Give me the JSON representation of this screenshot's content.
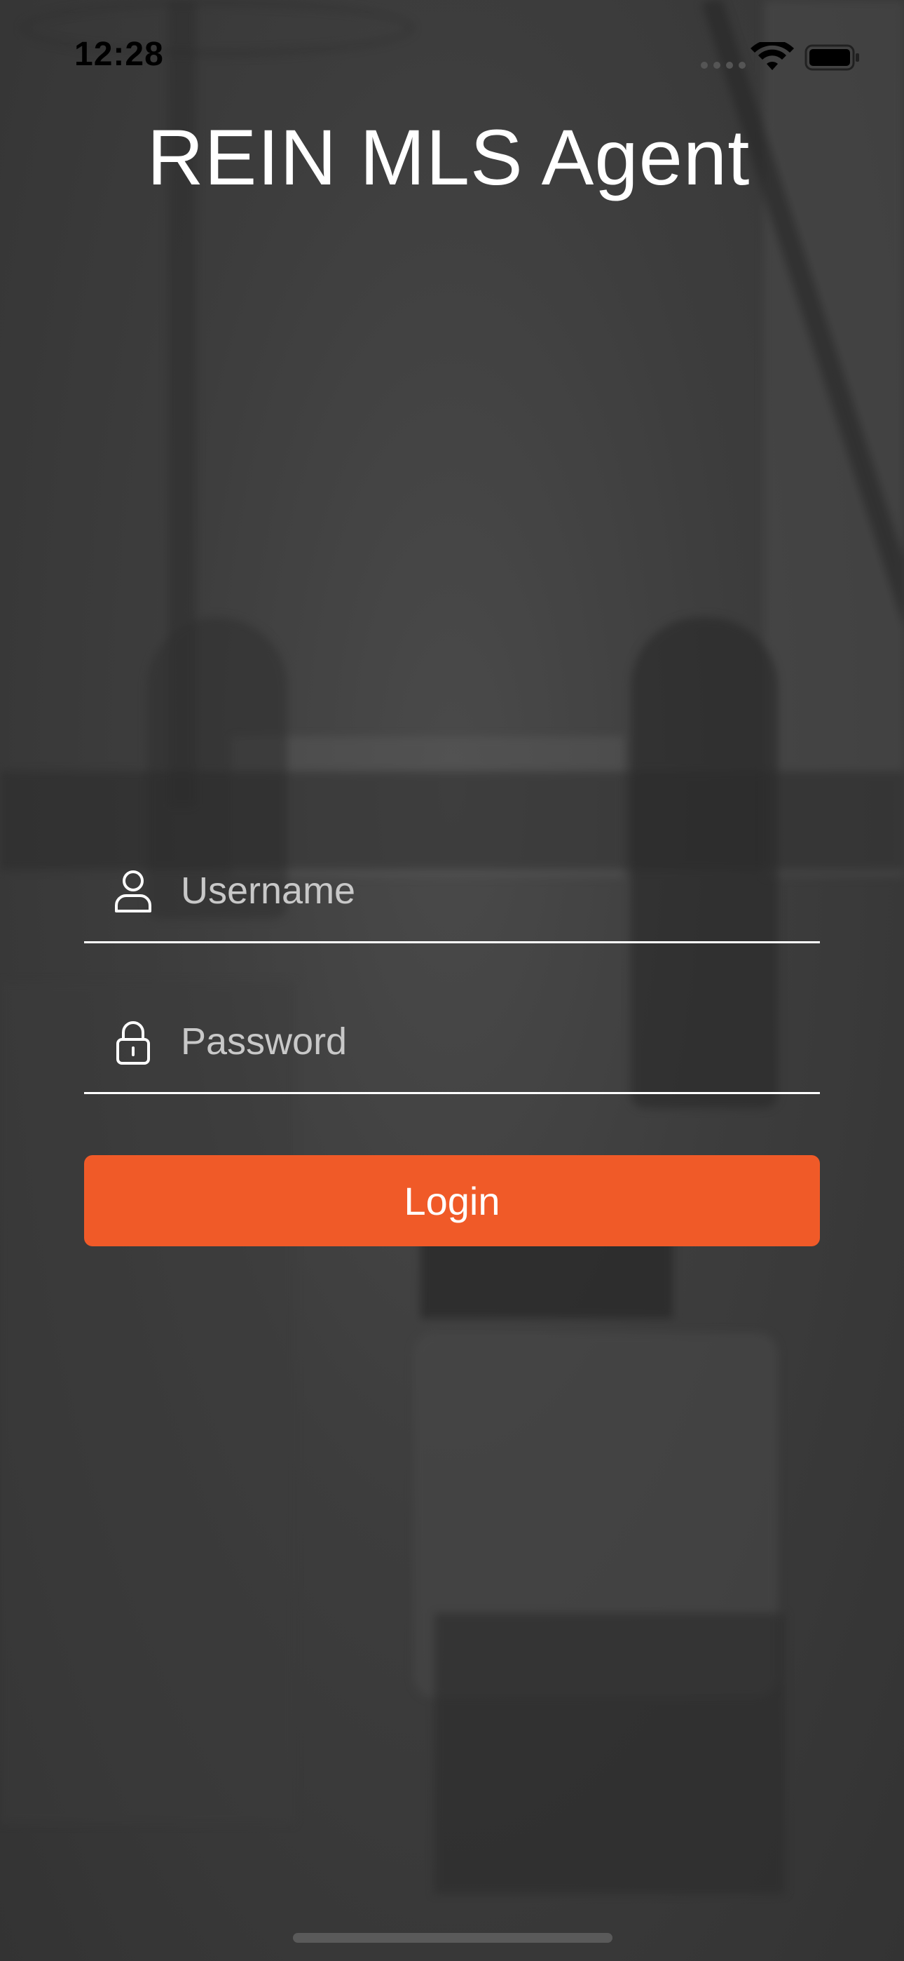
{
  "status_bar": {
    "time": "12:28",
    "icons": [
      "signal-dots-icon",
      "wifi-icon",
      "battery-icon"
    ]
  },
  "app": {
    "title": "REIN MLS Agent"
  },
  "form": {
    "username": {
      "icon": "user-icon",
      "placeholder": "Username",
      "value": ""
    },
    "password": {
      "icon": "lock-icon",
      "placeholder": "Password",
      "value": ""
    },
    "login_label": "Login"
  },
  "colors": {
    "accent": "#f05a28",
    "text": "#ffffff",
    "background": "#3a3a3a"
  }
}
